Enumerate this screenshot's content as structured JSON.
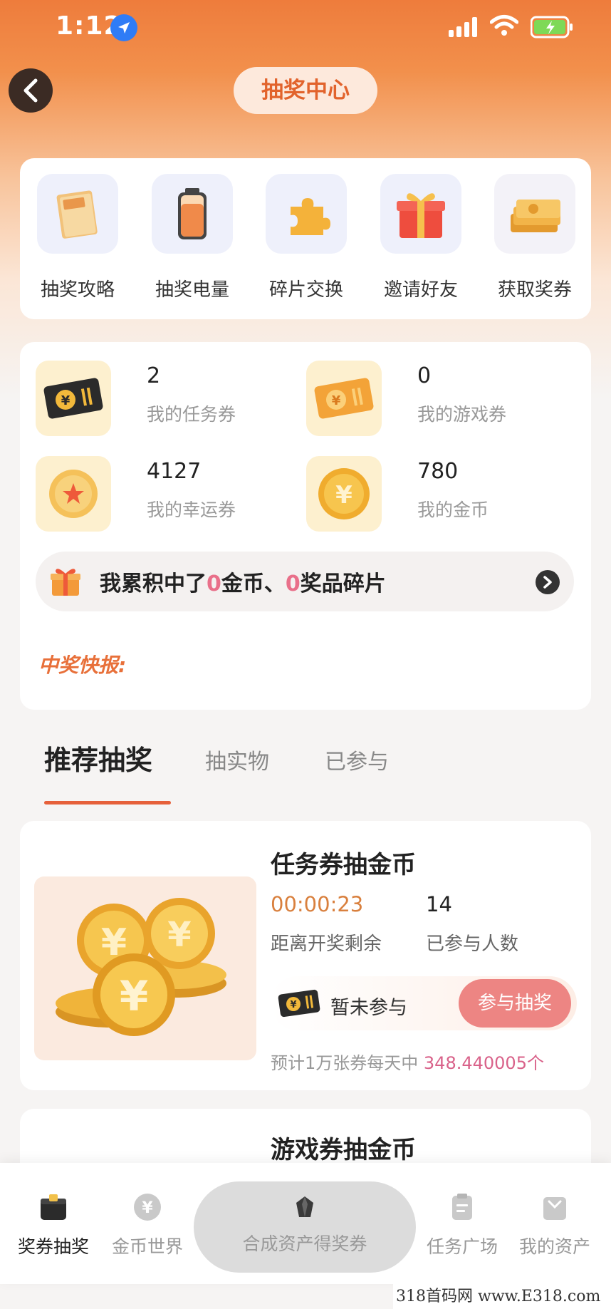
{
  "status_bar": {
    "time": "1:12"
  },
  "header": {
    "title": "抽奖中心"
  },
  "quick_actions": [
    {
      "label": "抽奖攻略",
      "icon": "guide-book-icon"
    },
    {
      "label": "抽奖电量",
      "icon": "battery-icon"
    },
    {
      "label": "碎片交换",
      "icon": "puzzle-piece-icon"
    },
    {
      "label": "邀请好友",
      "icon": "gift-box-icon"
    },
    {
      "label": "获取奖券",
      "icon": "tickets-icon"
    }
  ],
  "assets": [
    {
      "value": "2",
      "label": "我的任务券"
    },
    {
      "value": "0",
      "label": "我的游戏券"
    },
    {
      "value": "4127",
      "label": "我的幸运券"
    },
    {
      "value": "780",
      "label": "我的金币"
    }
  ],
  "accumulated": {
    "prefix": "我累积中了",
    "coins": "0",
    "coins_unit": "金币、",
    "fragments": "0",
    "fragments_unit": "奖品碎片"
  },
  "news": {
    "label": "中奖快报:"
  },
  "tabs": [
    "推荐抽奖",
    "抽实物",
    "已参与"
  ],
  "lottery": {
    "title": "任务券抽金币",
    "countdown": "00:00:23",
    "countdown_label": "距离开奖剩余",
    "participants": "14",
    "participants_label": "已参与人数",
    "status": "暂未参与",
    "join_label": "参与抽奖",
    "estimate_prefix": "预计1万张券每天中 ",
    "estimate_value": "348.440005个"
  },
  "lottery2": {
    "title": "游戏券抽金币"
  },
  "bottom_nav": [
    {
      "label": "奖券抽奖"
    },
    {
      "label": "金币世界"
    },
    {
      "label": "合成资产得奖券"
    },
    {
      "label": "任务广场"
    },
    {
      "label": "我的资产"
    }
  ],
  "watermark": "318首码网 www.E318.com",
  "colors": {
    "primary": "#e6603a",
    "title_orange": "#e2632c",
    "pink": "#e9708a",
    "countdown": "#d9803e",
    "join_button": "#ed8583"
  }
}
